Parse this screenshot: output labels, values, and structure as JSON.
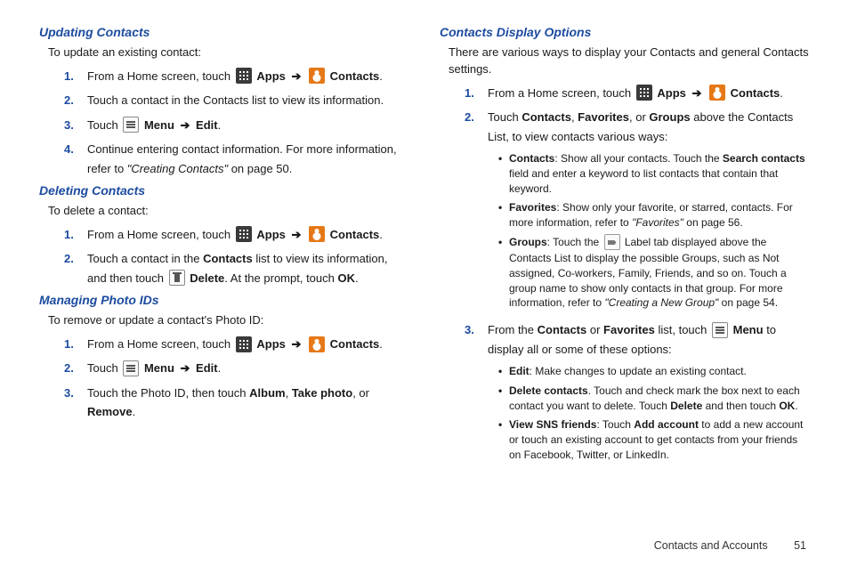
{
  "left": {
    "s1": {
      "title": "Updating Contacts",
      "intro": "To update an existing contact:",
      "n1": "1.",
      "n2": "2.",
      "n3": "3.",
      "n4": "4.",
      "t1a": "From a Home screen, touch ",
      "apps": "Apps",
      "arrow": "➔",
      "contacts": "Contacts",
      "period": ".",
      "t2": "Touch a contact in the Contacts list to view its information.",
      "t3a": "Touch ",
      "menu": "Menu",
      "edit": "Edit",
      "t4a": "Continue entering contact information. For more information, refer to ",
      "t4b": "\"Creating Contacts\"",
      "t4c": " on page 50."
    },
    "s2": {
      "title": "Deleting Contacts",
      "intro": "To delete a contact:",
      "n1": "1.",
      "n2": "2.",
      "t2a": "Touch a contact in the ",
      "t2b": "Contacts",
      "t2c": " list to view its information, and then touch ",
      "t2d": "Delete",
      "t2e": ". At the prompt, touch ",
      "t2f": "OK",
      "t2g": "."
    },
    "s3": {
      "title": "Managing Photo IDs",
      "intro": "To remove or update a contact's Photo ID:",
      "n1": "1.",
      "n2": "2.",
      "n3": "3.",
      "t3a": "Touch the Photo ID, then touch ",
      "t3b": "Album",
      "t3c": ", ",
      "t3d": "Take photo",
      "t3e": ", or ",
      "t3f": "Remove",
      "t3g": "."
    }
  },
  "right": {
    "s1": {
      "title": "Contacts Display Options",
      "intro": "There are various ways to display your Contacts and general Contacts settings.",
      "n1": "1.",
      "n2": "2.",
      "n3": "3.",
      "t2a": "Touch ",
      "t2b": "Contacts",
      "t2c": ", ",
      "t2d": "Favorites",
      "t2e": ", or ",
      "t2f": "Groups",
      "t2g": " above the Contacts List, to view contacts various ways:",
      "b1a": "Contacts",
      "b1b": ": Show all your contacts. Touch the ",
      "b1c": "Search contacts",
      "b1d": " field and enter a keyword to list contacts that contain that keyword.",
      "b2a": "Favorites",
      "b2b": ": Show only your favorite, or starred, contacts. For more information, refer to ",
      "b2c": "\"Favorites\"",
      "b2d": " on page 56.",
      "b3a": "Groups",
      "b3b": ": Touch the ",
      "b3c": " Label tab displayed above the Contacts List to display the possible Groups, such as Not assigned, Co-workers, Family, Friends, and so on. Touch a group name to show only contacts in that group. For more information, refer to ",
      "b3d": "\"Creating a New Group\"",
      "b3e": " on page 54.",
      "t3a": "From the ",
      "t3b": "Contacts",
      "t3c": " or ",
      "t3d": "Favorites",
      "t3e": " list, touch ",
      "t3f": "Menu",
      "t3g": " to display all or some of these options:",
      "c1a": "Edit",
      "c1b": ": Make changes to update an existing contact.",
      "c2a": "Delete contacts",
      "c2b": ". Touch and check mark the box next to each contact you want to delete. Touch ",
      "c2c": "Delete",
      "c2d": " and then touch ",
      "c2e": "OK",
      "c2f": ".",
      "c3a": "View SNS friends",
      "c3b": ": Touch ",
      "c3c": "Add account",
      "c3d": " to add a new account or touch an existing account to get contacts from your friends on Facebook, Twitter, or LinkedIn."
    }
  },
  "footer": {
    "section": "Contacts and Accounts",
    "page": "51"
  },
  "bullet": "•"
}
